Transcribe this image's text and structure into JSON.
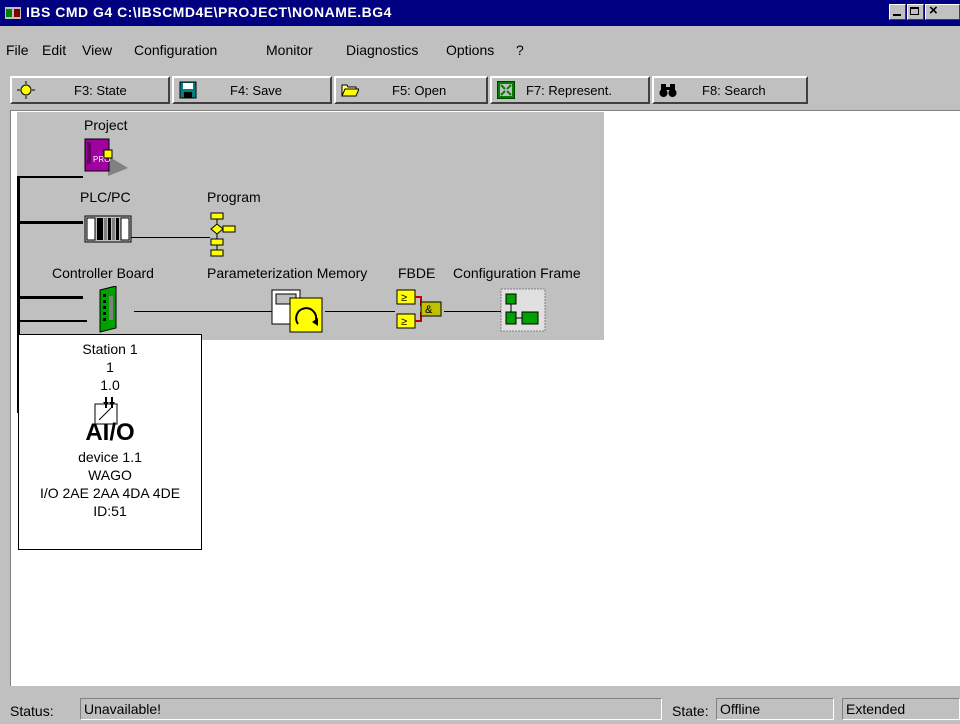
{
  "window": {
    "title": "IBS CMD G4 C:\\IBSCMD4E\\PROJECT\\NONAME.BG4"
  },
  "menu": [
    {
      "label": "File"
    },
    {
      "label": "Edit"
    },
    {
      "label": "View"
    },
    {
      "label": "Configuration"
    },
    {
      "label": "Monitor"
    },
    {
      "label": "Diagnostics"
    },
    {
      "label": "Options"
    },
    {
      "label": "?"
    }
  ],
  "toolbar": [
    {
      "label": "F3: State",
      "icon": "state-icon"
    },
    {
      "label": "F4: Save",
      "icon": "save-icon"
    },
    {
      "label": "F5: Open",
      "icon": "open-folder-icon"
    },
    {
      "label": "F7: Represent.",
      "icon": "represent-icon"
    },
    {
      "label": "F8: Search",
      "icon": "binoculars-icon"
    }
  ],
  "tree": {
    "project": "Project",
    "plc": "PLC/PC",
    "program": "Program",
    "controller": "Controller Board",
    "param_memory": "Parameterization Memory",
    "fbde": "FBDE",
    "config_frame": "Configuration Frame"
  },
  "station": {
    "name": "Station 1",
    "number": "1",
    "address": "1.0",
    "icon_text": "AI/O",
    "device": "device 1.1",
    "vendor": "WAGO",
    "type": "I/O 2AE 2AA 4DA 4DE",
    "id": "ID:51"
  },
  "status": {
    "status_label": "Status:",
    "status_value": "Unavailable!",
    "state_label": "State:",
    "state_value": "Offline",
    "mode_value": "Extended"
  }
}
